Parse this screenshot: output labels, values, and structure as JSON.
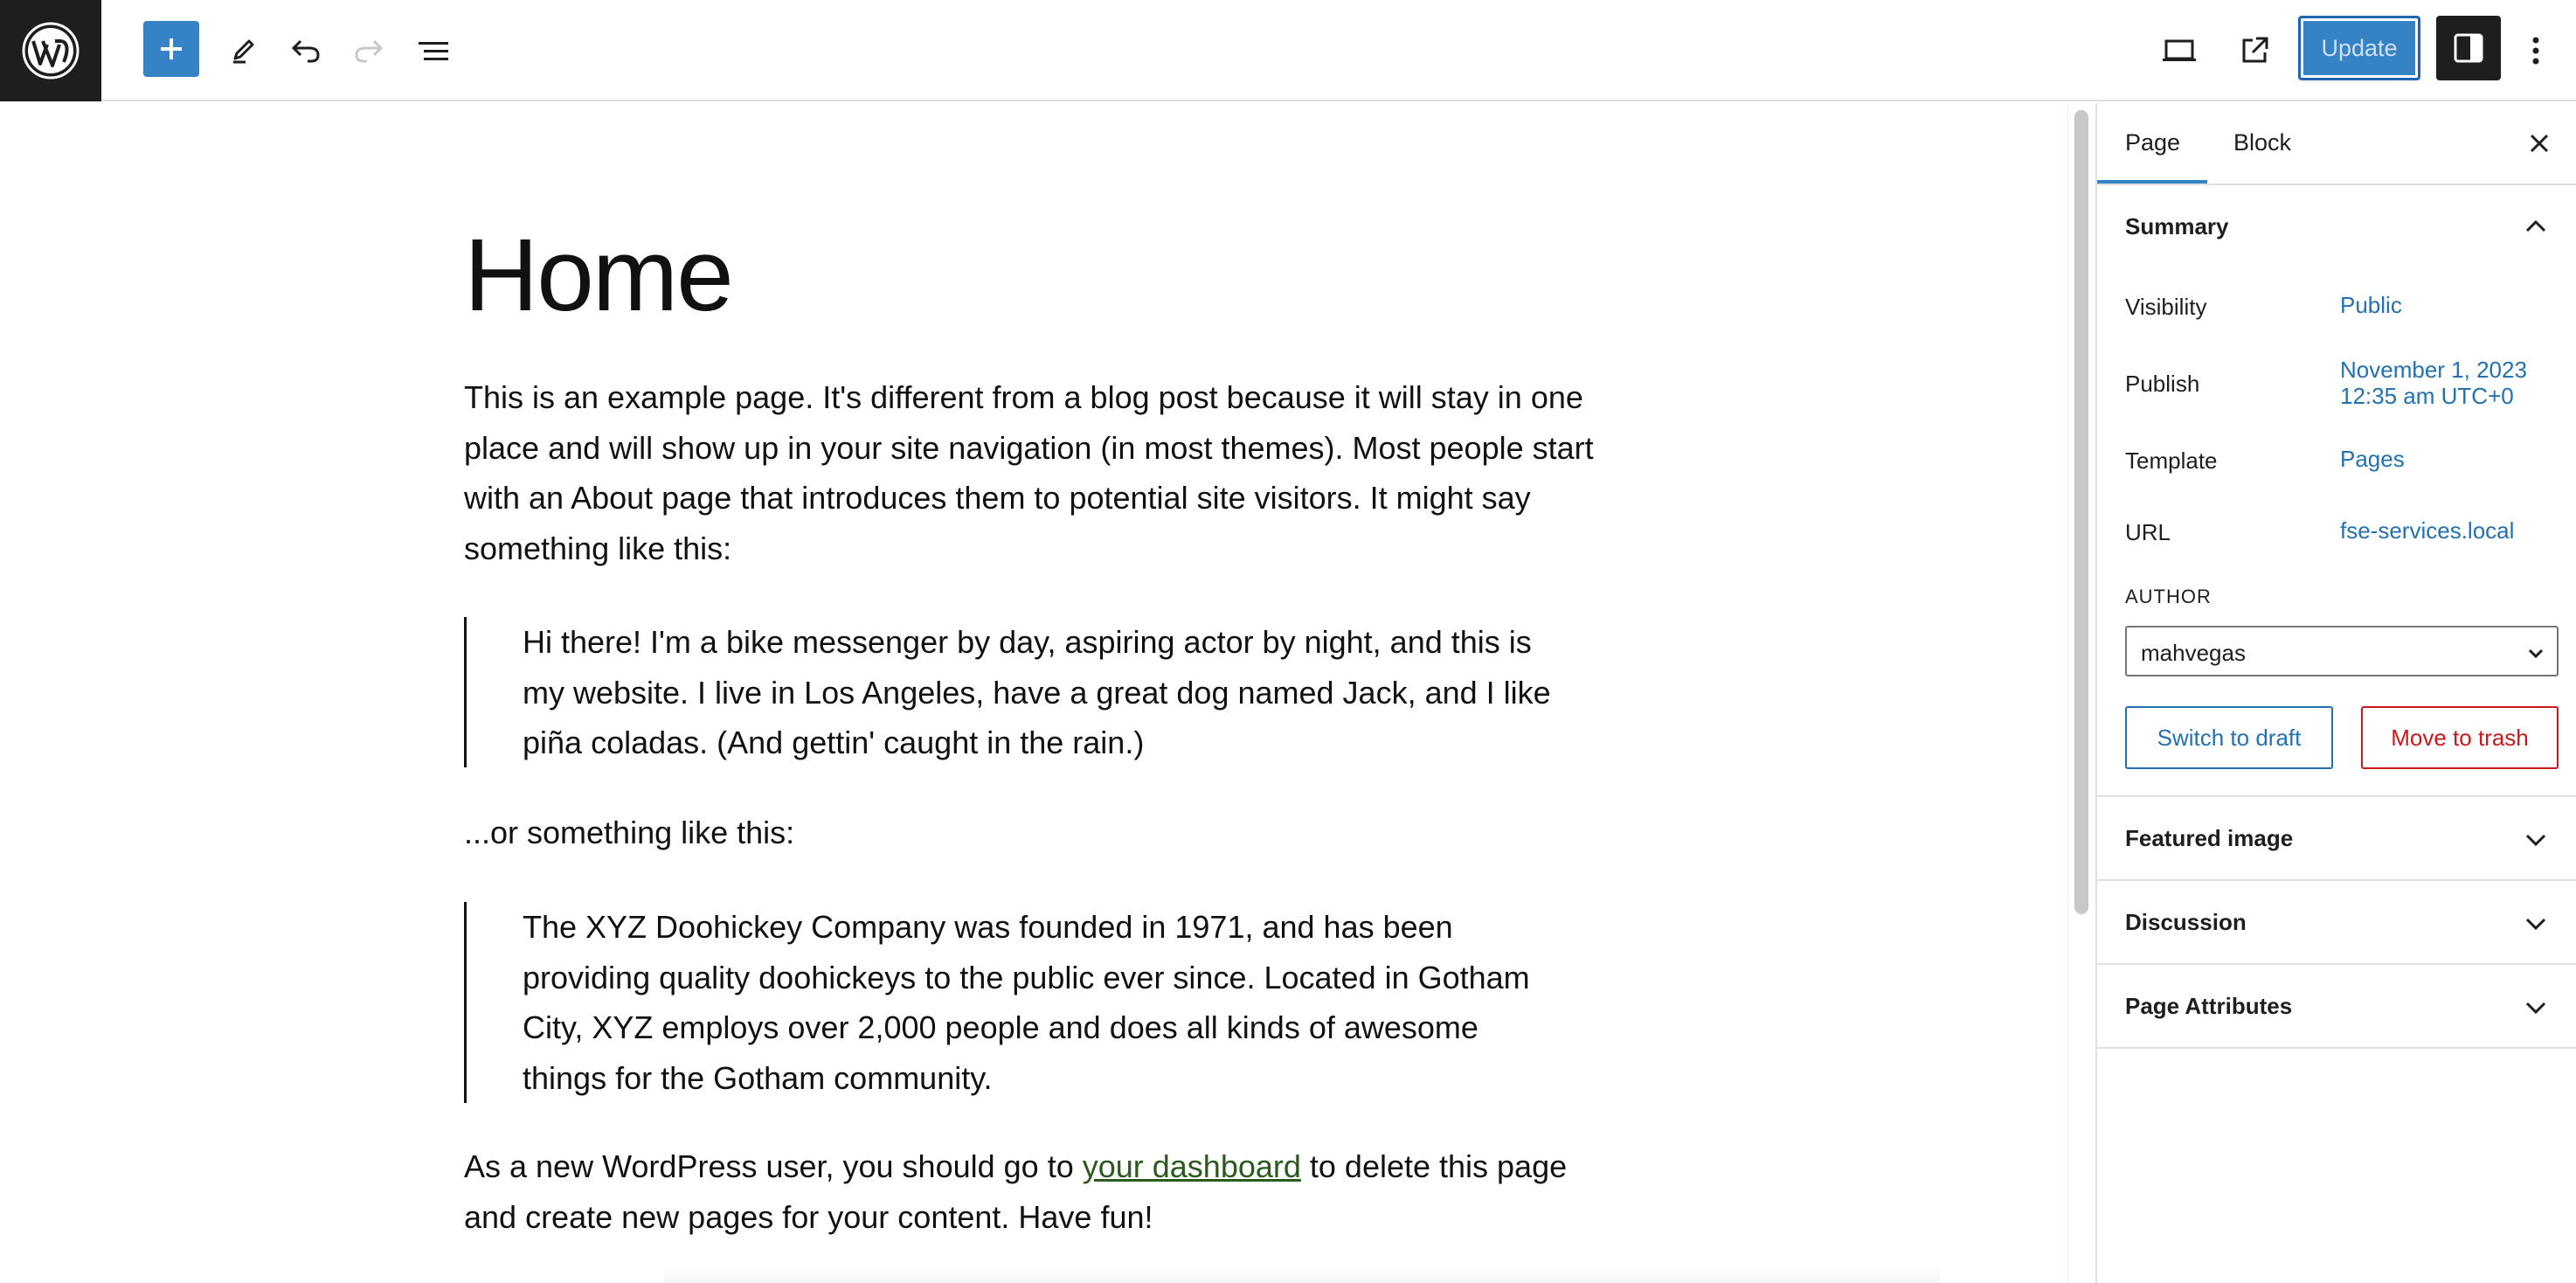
{
  "toolbar": {
    "logo_icon": "wordpress-logo",
    "icons": [
      "plus-icon",
      "pencil-icon",
      "undo-icon",
      "redo-icon",
      "list-view-icon",
      "desktop-preview-icon",
      "external-link-icon",
      "sidebar-toggle-icon",
      "more-vertical-icon"
    ],
    "update_label": "Update",
    "accent_color": "#3582c4"
  },
  "editor": {
    "title": "Home",
    "paragraph_1": "This is an example page. It's different from a blog post because it will stay in one place and will show up in your site navigation (in most themes). Most people start with an About page that introduces them to potential site visitors. It might say something like this:",
    "quote_1": "Hi there! I'm a bike messenger by day, aspiring actor by night, and this is my website. I live in Los Angeles, have a great dog named Jack, and I like piña coladas. (And gettin' caught in the rain.)",
    "paragraph_2": "...or something like this:",
    "quote_2": "The XYZ Doohickey Company was founded in 1971, and has been providing quality doohickeys to the public ever since. Located in Gotham City, XYZ employs over 2,000 people and does all kinds of awesome things for the Gotham community.",
    "paragraph_3_before": "As a new WordPress user, you should go to ",
    "paragraph_3_link": "your dashboard",
    "paragraph_3_after": " to delete this page and create new pages for your content. Have fun!"
  },
  "sidebar": {
    "tabs": [
      {
        "label": "Page"
      },
      {
        "label": "Block"
      }
    ],
    "summary": {
      "title": "Summary",
      "visibility_label": "Visibility",
      "visibility_value": "Public",
      "publish_label": "Publish",
      "publish_value_line1": "November 1, 2023",
      "publish_value_line2": "12:35 am UTC+0",
      "template_label": "Template",
      "template_value": "Pages",
      "url_label": "URL",
      "url_value": "fse-services.local",
      "author_label": "AUTHOR",
      "author_value": "mahvegas",
      "switch_draft_label": "Switch to draft",
      "move_trash_label": "Move to trash"
    },
    "panels": [
      {
        "title": "Featured image"
      },
      {
        "title": "Discussion"
      },
      {
        "title": "Page Attributes"
      }
    ]
  }
}
